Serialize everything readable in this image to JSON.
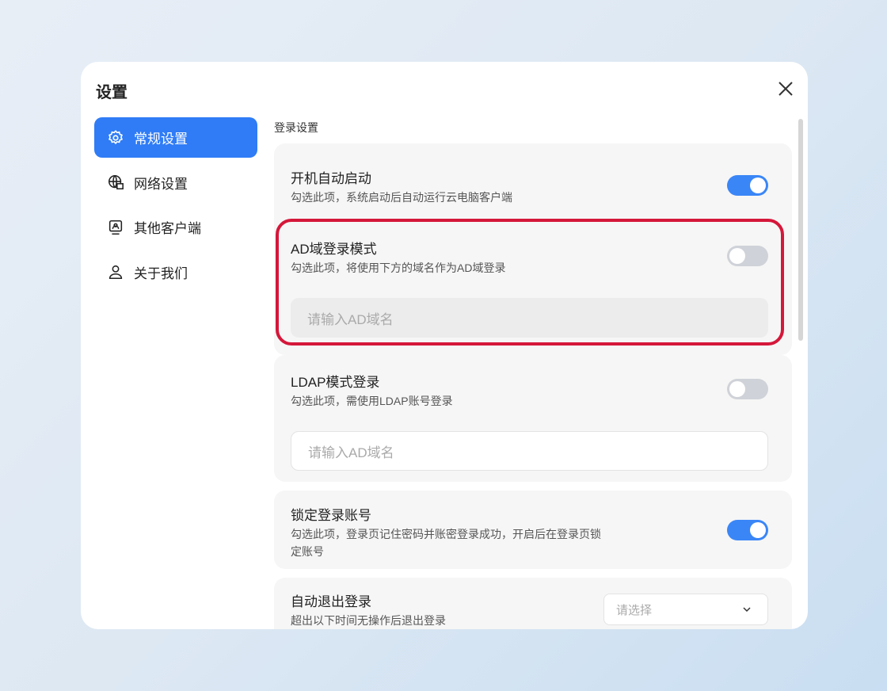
{
  "dialog": {
    "title": "设置"
  },
  "nav": [
    {
      "label": "常规设置",
      "icon": "gear-icon",
      "active": true
    },
    {
      "label": "网络设置",
      "icon": "globe-icon"
    },
    {
      "label": "其他客户端",
      "icon": "monitor-icon"
    },
    {
      "label": "关于我们",
      "icon": "user-icon"
    }
  ],
  "section": {
    "label": "登录设置"
  },
  "settings": {
    "autostart": {
      "title": "开机自动启动",
      "desc": "勾选此项，系统启动后自动运行云电脑客户端",
      "enabled": true
    },
    "ad": {
      "title": "AD域登录模式",
      "desc": "勾选此项，将使用下方的域名作为AD域登录",
      "enabled": false,
      "placeholder": "请输入AD域名"
    },
    "ldap": {
      "title": "LDAP模式登录",
      "desc": "勾选此项，需使用LDAP账号登录",
      "enabled": false,
      "placeholder": "请输入AD域名"
    },
    "lock": {
      "title": "锁定登录账号",
      "desc": "勾选此项，登录页记住密码并账密登录成功，开启后在登录页锁定账号",
      "enabled": true
    },
    "autologout": {
      "title": "自动退出登录",
      "desc": "超出以下时间无操作后退出登录",
      "placeholder": "请选择"
    }
  },
  "colors": {
    "accent": "#2f7cf6",
    "highlight": "#d5173a"
  }
}
